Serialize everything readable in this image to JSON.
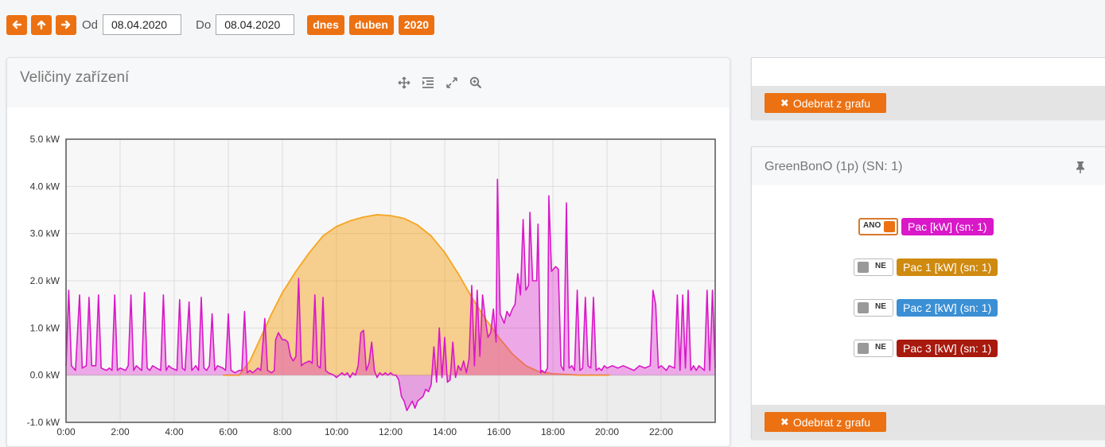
{
  "toolbar": {
    "from_label": "Od",
    "from_value": "08.04.2020",
    "to_label": "Do",
    "to_value": "08.04.2020",
    "today_label": "dnes",
    "month_label": "duben",
    "year_label": "2020",
    "nav_icons": [
      "arrow-left-icon",
      "arrow-up-icon",
      "arrow-right-icon"
    ],
    "accent_color": "#ec7112"
  },
  "chart_panel": {
    "title": "Veličiny zařízení",
    "tool_icons": [
      "move-icon",
      "indent-icon",
      "expand-icon",
      "zoom-icon"
    ]
  },
  "chart_data": {
    "type": "area",
    "x_ticks": [
      "0:00",
      "2:00",
      "4:00",
      "6:00",
      "8:00",
      "10:00",
      "12:00",
      "14:00",
      "16:00",
      "18:00",
      "20:00",
      "22:00"
    ],
    "y_ticks": [
      "5.0 kW",
      "4.0 kW",
      "3.0 kW",
      "2.0 kW",
      "1.0 kW",
      "0.0 kW",
      "-1.0 kW"
    ],
    "xlim": [
      0,
      24
    ],
    "ylim": [
      -1,
      5
    ],
    "grid": true,
    "series": [
      {
        "color": "#f5a623",
        "points": [
          [
            5.8,
            0
          ],
          [
            6.4,
            0
          ],
          [
            6.8,
            0.3
          ],
          [
            7.2,
            0.8
          ],
          [
            7.6,
            1.3
          ],
          [
            8.0,
            1.75
          ],
          [
            8.5,
            2.2
          ],
          [
            9.0,
            2.6
          ],
          [
            9.5,
            2.95
          ],
          [
            10.0,
            3.15
          ],
          [
            10.5,
            3.27
          ],
          [
            11.0,
            3.35
          ],
          [
            11.5,
            3.4
          ],
          [
            12.0,
            3.38
          ],
          [
            12.5,
            3.32
          ],
          [
            13.0,
            3.18
          ],
          [
            13.5,
            2.95
          ],
          [
            14.0,
            2.6
          ],
          [
            14.5,
            2.15
          ],
          [
            15.0,
            1.65
          ],
          [
            15.5,
            1.2
          ],
          [
            16.0,
            0.8
          ],
          [
            16.5,
            0.45
          ],
          [
            17.0,
            0.2
          ],
          [
            17.5,
            0.07
          ],
          [
            18.0,
            0.03
          ],
          [
            19.0,
            0
          ],
          [
            20.1,
            0
          ]
        ]
      },
      {
        "color": "#d918c8",
        "points": [
          [
            0,
            0.2
          ],
          [
            0.1,
            1.8
          ],
          [
            0.2,
            0.2
          ],
          [
            0.35,
            0.1
          ],
          [
            0.5,
            1.7
          ],
          [
            0.6,
            0.15
          ],
          [
            0.75,
            0.2
          ],
          [
            0.85,
            1.65
          ],
          [
            0.95,
            0.2
          ],
          [
            1.1,
            0.2
          ],
          [
            1.2,
            1.7
          ],
          [
            1.3,
            0.15
          ],
          [
            1.5,
            0.1
          ],
          [
            1.6,
            0.15
          ],
          [
            1.7,
            0.1
          ],
          [
            1.8,
            1.7
          ],
          [
            1.9,
            0.1
          ],
          [
            2.0,
            0.15
          ],
          [
            2.2,
            0.1
          ],
          [
            2.3,
            0.2
          ],
          [
            2.4,
            1.7
          ],
          [
            2.5,
            0.1
          ],
          [
            2.6,
            0.2
          ],
          [
            2.8,
            0.1
          ],
          [
            2.9,
            1.75
          ],
          [
            3.0,
            0.15
          ],
          [
            3.1,
            0.1
          ],
          [
            3.2,
            0.2
          ],
          [
            3.35,
            0.15
          ],
          [
            3.5,
            0.1
          ],
          [
            3.6,
            1.7
          ],
          [
            3.7,
            0.1
          ],
          [
            3.8,
            0.2
          ],
          [
            3.9,
            0.15
          ],
          [
            4.1,
            0.1
          ],
          [
            4.2,
            1.6
          ],
          [
            4.3,
            0.15
          ],
          [
            4.4,
            0.1
          ],
          [
            4.55,
            1.55
          ],
          [
            4.65,
            0.1
          ],
          [
            4.8,
            0.2
          ],
          [
            4.9,
            0.1
          ],
          [
            5.0,
            1.65
          ],
          [
            5.1,
            0.15
          ],
          [
            5.2,
            0.1
          ],
          [
            5.3,
            0.2
          ],
          [
            5.4,
            1.3
          ],
          [
            5.5,
            0.1
          ],
          [
            5.6,
            0.2
          ],
          [
            5.8,
            0.15
          ],
          [
            5.9,
            0.1
          ],
          [
            6.0,
            1.3
          ],
          [
            6.1,
            0.1
          ],
          [
            6.25,
            0.05
          ],
          [
            6.4,
            0.1
          ],
          [
            6.5,
            0.1
          ],
          [
            6.6,
            1.35
          ],
          [
            6.7,
            0.05
          ],
          [
            6.8,
            0.1
          ],
          [
            6.9,
            0.05
          ],
          [
            7.0,
            0.1
          ],
          [
            7.1,
            0.15
          ],
          [
            7.2,
            0.1
          ],
          [
            7.35,
            1.2
          ],
          [
            7.45,
            0.1
          ],
          [
            7.6,
            0.05
          ],
          [
            7.7,
            0.1
          ],
          [
            7.75,
            0.75
          ],
          [
            7.85,
            0.9
          ],
          [
            8.0,
            0.75
          ],
          [
            8.1,
            0.75
          ],
          [
            8.2,
            0.7
          ],
          [
            8.3,
            0.4
          ],
          [
            8.4,
            0.3
          ],
          [
            8.5,
            0.4
          ],
          [
            8.6,
            2.05
          ],
          [
            8.7,
            0.2
          ],
          [
            8.8,
            0.25
          ],
          [
            9.0,
            0.3
          ],
          [
            9.1,
            0.25
          ],
          [
            9.2,
            1.7
          ],
          [
            9.3,
            0.2
          ],
          [
            9.4,
            0.15
          ],
          [
            9.5,
            1.65
          ],
          [
            9.6,
            0.1
          ],
          [
            9.7,
            0.05
          ],
          [
            9.9,
            0
          ],
          [
            10.0,
            -0.05
          ],
          [
            10.1,
            0
          ],
          [
            10.2,
            0.05
          ],
          [
            10.3,
            0
          ],
          [
            10.4,
            0.05
          ],
          [
            10.5,
            -0.05
          ],
          [
            10.6,
            0.05
          ],
          [
            10.7,
            0
          ],
          [
            10.8,
            0.2
          ],
          [
            10.9,
            0.9
          ],
          [
            11.0,
            0.95
          ],
          [
            11.1,
            0.1
          ],
          [
            11.2,
            0.25
          ],
          [
            11.3,
            0.7
          ],
          [
            11.4,
            0.1
          ],
          [
            11.5,
            -0.05
          ],
          [
            11.6,
            0.05
          ],
          [
            11.7,
            0
          ],
          [
            11.8,
            0.05
          ],
          [
            11.9,
            0
          ],
          [
            12.0,
            0.05
          ],
          [
            12.1,
            0
          ],
          [
            12.2,
            0
          ],
          [
            12.3,
            -0.1
          ],
          [
            12.4,
            -0.45
          ],
          [
            12.5,
            -0.55
          ],
          [
            12.6,
            -0.75
          ],
          [
            12.7,
            -0.65
          ],
          [
            12.8,
            -0.55
          ],
          [
            12.9,
            -0.7
          ],
          [
            13.0,
            -0.55
          ],
          [
            13.1,
            -0.5
          ],
          [
            13.2,
            -0.45
          ],
          [
            13.3,
            -0.3
          ],
          [
            13.4,
            -0.35
          ],
          [
            13.5,
            -0.2
          ],
          [
            13.6,
            0.6
          ],
          [
            13.7,
            -0.15
          ],
          [
            13.8,
            1.0
          ],
          [
            13.9,
            -0.05
          ],
          [
            14.0,
            0.8
          ],
          [
            14.1,
            -0.15
          ],
          [
            14.2,
            -0.1
          ],
          [
            14.3,
            0.7
          ],
          [
            14.4,
            -0.05
          ],
          [
            14.5,
            0.2
          ],
          [
            14.6,
            0.1
          ],
          [
            14.7,
            0.3
          ],
          [
            14.8,
            0.05
          ],
          [
            14.9,
            0.35
          ],
          [
            15.0,
            1.9
          ],
          [
            15.1,
            0.2
          ],
          [
            15.2,
            1.8
          ],
          [
            15.3,
            0.4
          ],
          [
            15.4,
            1.7
          ],
          [
            15.5,
            1.2
          ],
          [
            15.6,
            0.8
          ],
          [
            15.7,
            0.9
          ],
          [
            15.8,
            1.4
          ],
          [
            15.9,
            0.7
          ],
          [
            15.95,
            4.15
          ],
          [
            16.05,
            1.3
          ],
          [
            16.2,
            1.1
          ],
          [
            16.3,
            1.35
          ],
          [
            16.4,
            1.25
          ],
          [
            16.5,
            1.4
          ],
          [
            16.6,
            1.5
          ],
          [
            16.7,
            2.15
          ],
          [
            16.8,
            1.7
          ],
          [
            16.9,
            3.3
          ],
          [
            17.0,
            1.8
          ],
          [
            17.1,
            1.9
          ],
          [
            17.15,
            3.45
          ],
          [
            17.25,
            2.0
          ],
          [
            17.4,
            2.0
          ],
          [
            17.45,
            3.2
          ],
          [
            17.55,
            0.05
          ],
          [
            17.6,
            0.1
          ],
          [
            17.7,
            0.05
          ],
          [
            17.8,
            0.15
          ],
          [
            17.85,
            3.8
          ],
          [
            17.95,
            2.2
          ],
          [
            18.1,
            2.3
          ],
          [
            18.2,
            2.25
          ],
          [
            18.3,
            0.2
          ],
          [
            18.4,
            0.1
          ],
          [
            18.5,
            3.65
          ],
          [
            18.6,
            0.15
          ],
          [
            18.7,
            0.2
          ],
          [
            18.8,
            0.1
          ],
          [
            18.9,
            1.8
          ],
          [
            19.0,
            0.1
          ],
          [
            19.1,
            0.15
          ],
          [
            19.2,
            1.65
          ],
          [
            19.3,
            0.2
          ],
          [
            19.4,
            0.15
          ],
          [
            19.5,
            1.65
          ],
          [
            19.6,
            0.1
          ],
          [
            19.7,
            0.15
          ],
          [
            19.8,
            0.1
          ],
          [
            19.9,
            0.2
          ],
          [
            20.0,
            0.15
          ],
          [
            20.2,
            0.2
          ],
          [
            20.4,
            0.15
          ],
          [
            20.6,
            0.2
          ],
          [
            20.8,
            0.15
          ],
          [
            21.0,
            0.1
          ],
          [
            21.2,
            0.2
          ],
          [
            21.4,
            0.15
          ],
          [
            21.6,
            0.2
          ],
          [
            21.7,
            1.8
          ],
          [
            21.8,
            1.5
          ],
          [
            21.9,
            0.15
          ],
          [
            22.0,
            0.2
          ],
          [
            22.2,
            0.1
          ],
          [
            22.3,
            0.2
          ],
          [
            22.5,
            0.15
          ],
          [
            22.6,
            1.7
          ],
          [
            22.7,
            0.1
          ],
          [
            22.8,
            1.7
          ],
          [
            22.9,
            0.15
          ],
          [
            23.0,
            1.8
          ],
          [
            23.1,
            0.1
          ],
          [
            23.2,
            0.2
          ],
          [
            23.3,
            0.1
          ],
          [
            23.4,
            0.2
          ],
          [
            23.5,
            0.15
          ],
          [
            23.6,
            0.1
          ],
          [
            23.7,
            1.8
          ],
          [
            23.8,
            0.1
          ],
          [
            23.9,
            1.8
          ],
          [
            24.0,
            0.15
          ]
        ]
      }
    ]
  },
  "right_top_panel": {
    "remove_label": "Odebrat z grafu"
  },
  "device_panel": {
    "title": "GreenBonO (1p) (SN: 1)",
    "pin_icon": "pin-icon",
    "remove_label": "Odebrat z grafu",
    "series": [
      {
        "toggle": "ANO",
        "on": true,
        "label": "Pac [kW] (sn: 1)",
        "color": "#d918c8"
      },
      {
        "toggle": "NE",
        "on": false,
        "label": "Pac 1 [kW] (sn: 1)",
        "color": "#cf8a10"
      },
      {
        "toggle": "NE",
        "on": false,
        "label": "Pac 2 [kW] (sn: 1)",
        "color": "#3b8fd4"
      },
      {
        "toggle": "NE",
        "on": false,
        "label": "Pac 3 [kW] (sn: 1)",
        "color": "#a8190e"
      }
    ]
  }
}
